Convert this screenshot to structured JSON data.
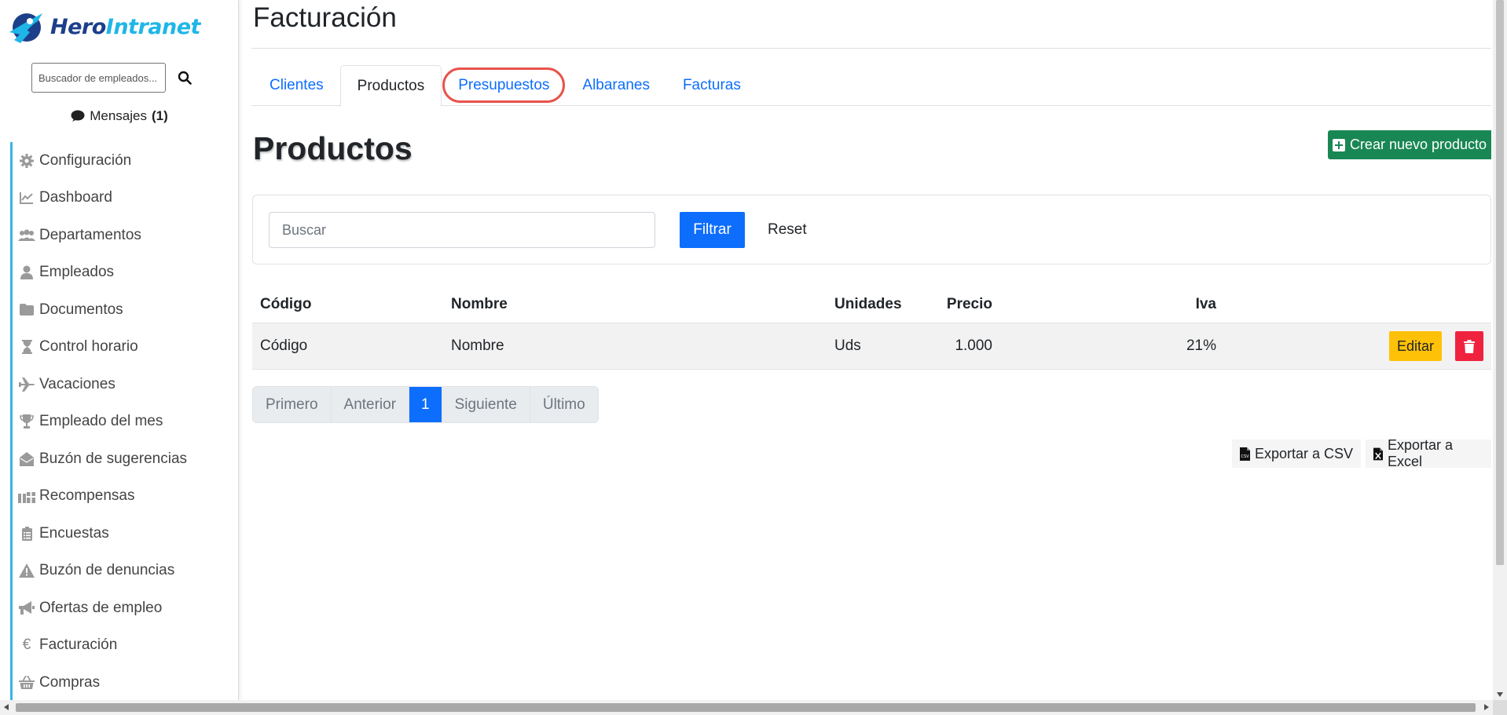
{
  "brand": {
    "name_part1": "Hero",
    "name_part2": "Intranet",
    "logo_icon": "hero-logo-icon"
  },
  "sidebar": {
    "search_placeholder": "Buscador de empleados...",
    "messages_label": "Mensajes",
    "messages_count": "(1)",
    "items": [
      {
        "label": "Configuración",
        "icon": "gear-icon"
      },
      {
        "label": "Dashboard",
        "icon": "chart-line-icon"
      },
      {
        "label": "Departamentos",
        "icon": "users-icon"
      },
      {
        "label": "Empleados",
        "icon": "user-icon"
      },
      {
        "label": "Documentos",
        "icon": "folder-icon"
      },
      {
        "label": "Control horario",
        "icon": "hourglass-icon"
      },
      {
        "label": "Vacaciones",
        "icon": "plane-icon"
      },
      {
        "label": "Empleado del mes",
        "icon": "trophy-icon"
      },
      {
        "label": "Buzón de sugerencias",
        "icon": "envelope-open-icon"
      },
      {
        "label": "Recompensas",
        "icon": "gift-icon"
      },
      {
        "label": "Encuestas",
        "icon": "clipboard-list-icon"
      },
      {
        "label": "Buzón de denuncias",
        "icon": "warning-icon"
      },
      {
        "label": "Ofertas de empleo",
        "icon": "megaphone-icon"
      },
      {
        "label": "Facturación",
        "icon": "euro-icon"
      },
      {
        "label": "Compras",
        "icon": "basket-icon"
      }
    ]
  },
  "header": {
    "title": "Facturación"
  },
  "tabs": [
    {
      "label": "Clientes",
      "active": false
    },
    {
      "label": "Productos",
      "active": true
    },
    {
      "label": "Presupuestos",
      "active": false,
      "highlighted": true
    },
    {
      "label": "Albaranes",
      "active": false
    },
    {
      "label": "Facturas",
      "active": false
    }
  ],
  "main": {
    "section_title": "Productos",
    "create_button": "Crear nuevo producto",
    "filter": {
      "placeholder": "Buscar",
      "filter_label": "Filtrar",
      "reset_label": "Reset"
    },
    "table": {
      "headers": {
        "code": "Código",
        "name": "Nombre",
        "price": "Precio",
        "units": "Unidades",
        "iva": "Iva"
      },
      "rows": [
        {
          "code": "Código",
          "name": "Nombre",
          "price": "1.000",
          "units": "Uds",
          "iva": "21%",
          "edit_label": "Editar"
        }
      ]
    },
    "pagination": {
      "first": "Primero",
      "prev": "Anterior",
      "current": "1",
      "next": "Siguiente",
      "last": "Último"
    },
    "export": {
      "csv": "Exportar a CSV",
      "excel": "Exportar a Excel"
    }
  },
  "colors": {
    "primary": "#0d6efd",
    "success": "#198754",
    "warning": "#ffc107",
    "danger": "#f0233f",
    "highlight_circle": "#e8534a",
    "sidebar_accent": "#37b5e8"
  }
}
